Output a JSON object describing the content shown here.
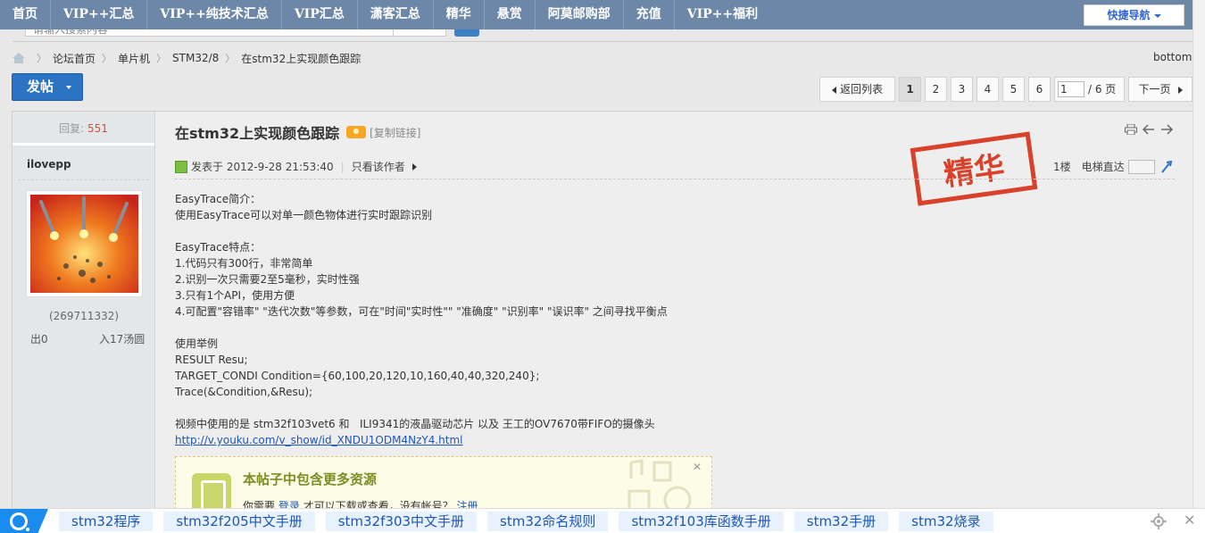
{
  "topnav": {
    "items": [
      "首页",
      "VIP++汇总",
      "VIP++纯技术汇总",
      "VIP汇总",
      "潇客汇总",
      "精华",
      "悬赏",
      "阿莫邮购部",
      "充值",
      "VIP++福利"
    ],
    "quick_nav": "快捷导航",
    "search_placeholder": "请输入搜索内容"
  },
  "breadcrumb": {
    "items": [
      "论坛首页",
      "单片机",
      "STM32/8",
      "在stm32上实现颜色跟踪"
    ],
    "bottom_link": "bottom↓"
  },
  "toolbar": {
    "post_button": "发帖",
    "back_to_list": "返回列表",
    "pages": [
      "1",
      "2",
      "3",
      "4",
      "5",
      "6"
    ],
    "current_page": "1",
    "total_pages_label": "/ 6 页",
    "next_page": "下一页"
  },
  "post": {
    "reply_label": "回复:",
    "reply_count": "551",
    "author": "ilovepp",
    "uid": "(269711332)",
    "stat_out": "出0",
    "stat_in": "入17汤圆",
    "title": "在stm32上实现颜色跟踪",
    "copy_link": "[复制链接]",
    "posted_at": "发表于 2012-9-28 21:53:40",
    "author_only": "只看该作者",
    "floor": "1楼",
    "goto_floor": "电梯直达",
    "stamp_text": "精华",
    "content_lines": [
      "EasyTrace简介：",
      "使用EasyTrace可以对单一颜色物体进行实时跟踪识别",
      "",
      "EasyTrace特点：",
      "1.代码只有300行，非常简单",
      "2.识别一次只需要2至5毫秒，实时性强",
      "3.只有1个API，使用方便",
      "4.可配置\"容错率\" \"迭代次数\"等参数，可在\"时间\"实时性\"\" \"准确度\" \"识别率\" \"误识率\" 之间寻找平衡点",
      "",
      "使用举例",
      "RESULT Resu;",
      "TARGET_CONDI Condition={60,100,20,120,10,160,40,40,320,240};",
      "Trace(&Condition,&Resu);",
      "",
      "视频中使用的是 stm32f103vet6 和   ILI9341的液晶驱动芯片 以及 王工的OV7670带FIFO的摄像头"
    ],
    "video_link": "http://v.youku.com/v_show/id_XNDU1ODM4NzY4.html",
    "resource_title": "本帖子中包含更多资源",
    "resource_desc_pre": "你需要",
    "resource_login": "登录",
    "resource_desc_mid": "才可以下载或查看，没有帐号？",
    "resource_register": "注册"
  },
  "suggestions": {
    "items": [
      "stm32程序",
      "stm32f205中文手册",
      "stm32f303中文手册",
      "stm32命名规则",
      "stm32f103库函数手册",
      "stm32手册",
      "stm32烧录"
    ]
  },
  "colors": {
    "nav_bg": "#6d87a8",
    "accent_blue": "#2b73c3",
    "stamp_red": "#d9412b",
    "reply_count": "#e0473c"
  }
}
